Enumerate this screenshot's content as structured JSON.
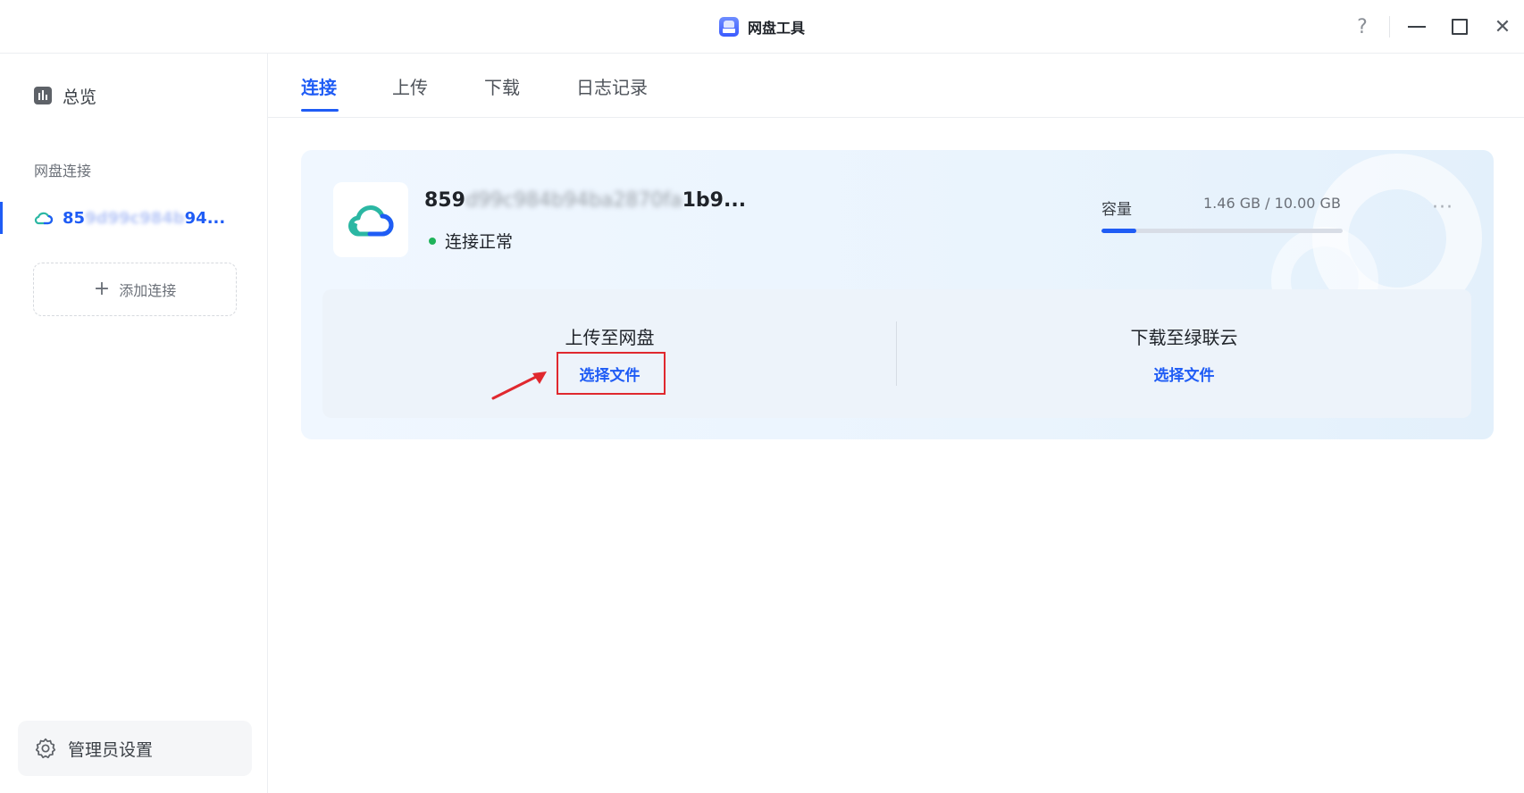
{
  "window": {
    "title": "网盘工具",
    "help_glyph": "?",
    "close_glyph": "✕"
  },
  "sidebar": {
    "overview_label": "总览",
    "section_label": "网盘连接",
    "connection_prefix": "85",
    "connection_masked": "9d99c984b",
    "connection_suffix": "94...",
    "add_connection_label": "添加连接",
    "admin_label": "管理员设置"
  },
  "tabs": [
    "连接",
    "上传",
    "下载",
    "日志记录"
  ],
  "card": {
    "name_prefix": "859",
    "name_masked": "d99c984b94ba2870fa",
    "name_suffix": "1b9...",
    "status_text": "连接正常",
    "capacity_label": "容量",
    "capacity_value": "1.46 GB / 10.00 GB",
    "capacity_used_fraction": 0.146,
    "more_glyph": "···",
    "upload_title": "上传至网盘",
    "upload_link": "选择文件",
    "download_title": "下载至绿联云",
    "download_link": "选择文件"
  },
  "colors": {
    "accent": "#1f5cf5",
    "status_ok": "#1fb35a",
    "annotation": "#e0282e"
  }
}
